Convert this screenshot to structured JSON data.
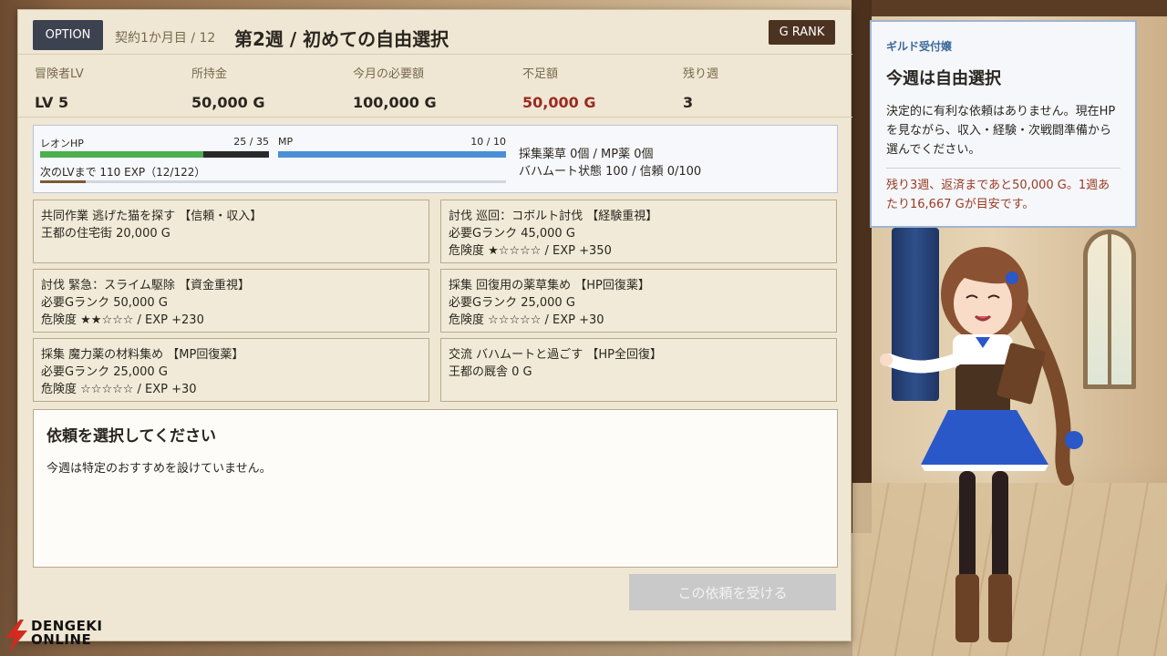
{
  "header": {
    "option_label": "OPTION",
    "contract": "契約1か月目 / 12",
    "title": "第2週 / 初めての自由選択",
    "rank": "G RANK"
  },
  "stats": [
    {
      "label": "冒険者LV",
      "value": "LV 5"
    },
    {
      "label": "所持金",
      "value": "50,000 G"
    },
    {
      "label": "今月の必要額",
      "value": "100,000 G"
    },
    {
      "label": "不足額",
      "value": "50,000 G"
    },
    {
      "label": "残り週",
      "value": "3"
    }
  ],
  "status": {
    "hp_label": "レオンHP",
    "hp_text": "25 / 35",
    "hp_current": 25,
    "hp_max": 35,
    "mp_label": "MP",
    "mp_text": "10 / 10",
    "mp_current": 10,
    "mp_max": 10,
    "exp_text": "次のLVまで 110 EXP（12/122）",
    "exp_current": 12,
    "exp_max": 122,
    "items": "採集薬草 0個 / MP薬 0個",
    "bahamut": "バハムート状態 100 / 信頼 0/100",
    "colors": {
      "hp": "#4caf50",
      "mp": "#4a8fd6",
      "exp": "#7a5a34"
    }
  },
  "quests": [
    {
      "line1": "共同作業 逃げた猫を探す 【信頼・収入】",
      "line2": "王都の住宅街 20,000 G",
      "line3": ""
    },
    {
      "line1": "討伐 巡回：コボルト討伐 【経験重視】",
      "line2": "必要Gランク 45,000 G",
      "line3": "危険度 ★☆☆☆☆ / EXP +350"
    },
    {
      "line1": "討伐 緊急：スライム駆除 【資金重視】",
      "line2": "必要Gランク 50,000 G",
      "line3": "危険度 ★★☆☆☆ / EXP +230"
    },
    {
      "line1": "採集 回復用の薬草集め 【HP回復薬】",
      "line2": "必要Gランク 25,000 G",
      "line3": "危険度 ☆☆☆☆☆ / EXP +30"
    },
    {
      "line1": "採集 魔力薬の材料集め 【MP回復薬】",
      "line2": "必要Gランク 25,000 G",
      "line3": "危険度 ☆☆☆☆☆ / EXP +30"
    },
    {
      "line1": "交流 バハムートと過ごす 【HP全回復】",
      "line2": "王都の厩舎 0 G",
      "line3": ""
    }
  ],
  "detail": {
    "title": "依頼を選択してください",
    "text": "今週は特定のおすすめを設けていません。"
  },
  "accept_label": "この依頼を受ける",
  "guild": {
    "name": "ギルド受付嬢",
    "title": "今週は自由選択",
    "body": "決定的に有利な依頼はありません。現在HPを見ながら、収入・経験・次戦闘準備から選んでください。",
    "warning": "残り3週、返済まであと50,000 G。1週あたり16,667 Gが目安です。"
  },
  "watermark": {
    "line1": "DENGEKI",
    "line2": "ONLINE"
  }
}
